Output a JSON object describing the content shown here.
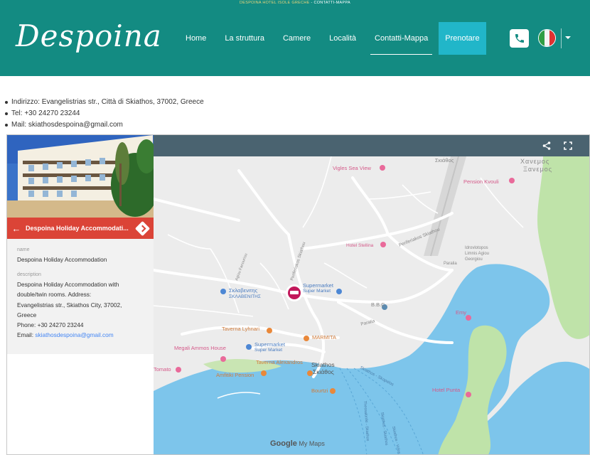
{
  "header": {
    "topline_a": "DESPOINA HOTEL ISOLE GRECHE",
    "topline_sep": " - ",
    "topline_b": "CONTATTI-MAPPA",
    "logo": "Despoina",
    "nav": [
      "Home",
      "La struttura",
      "Camere",
      "Località",
      "Contatti-Mappa"
    ],
    "book": "Prenotare",
    "phone_icon": "phone-icon",
    "language_flag": "italy-flag"
  },
  "contact": {
    "address": "Indirizzo: Evangelistrias str., Città di Skiathos, 37002, Greece",
    "tel": "Tel: +30 24270 23244",
    "mail": "Mail: skiathosdespoina@gmail.com"
  },
  "panel": {
    "title": "Despoina Holiday Accommodati...",
    "name_label": "name",
    "name_value": "Despoina Holiday Accommodation",
    "desc_label": "description",
    "desc_line1": "Despoina Holiday Accommodation with",
    "desc_line2": "double/twin rooms.  Address:",
    "desc_line3": "Evangelistrias str., Skiathos City, 37002,",
    "desc_line4": "Greece",
    "desc_phone": "Phone: +30 24270 23244",
    "desc_email_prefix": "Email: ",
    "desc_email": "skiathosdespoina@gmail.com"
  },
  "map": {
    "labels": {
      "vigles": "Vigles Sea View",
      "skiathos_top": "Σκιάθος",
      "xanemos1": "Χανεμος",
      "xanemos2": "Ξανεμος",
      "pension": "Pension Kvouli",
      "periferiakos_top": "Periferiakos Skiathou",
      "stellina": "Hotel Stellina",
      "agiou": "Agiou Fanouriou",
      "periferiakos_mid": "Periferiakos Skiathou",
      "idrovio1": "Idrovlotopos",
      "idrovio2": "Limnis Agiou",
      "idrovio3": "Georgiou",
      "paralia_top": "Paralia",
      "sklav1": "Σκλαβενιτης",
      "sklav2": "ΣΚΛΑΒΕΝΙΤΗΣ",
      "supermarket1": "Supermarket",
      "supermarket1b": "Super Market",
      "bbc": "B.B.C",
      "paralia_mid": "Paralia",
      "emy": "Emy",
      "taverna_lyhnari": "Taverna Lyhnari",
      "marmita": "MARMITA",
      "megali": "Megali Ammos House",
      "supermarket2": "Supermarket",
      "supermarket2b": "Super Market",
      "tomato": "Tomato",
      "taverna_alex": "Taverna Alexandros",
      "skiathos_city": "Skiathos",
      "skiathos_city_gr": "Σκιάθος",
      "amfitiki": "Amfitiki Pension",
      "bourtzi": "Bourtzi",
      "skopelos": "Skiathos - Skopelos",
      "hotel_punta": "Hotel Punta",
      "route1": "Skiathos - Volos",
      "route2": "Thessaloniki - Skiathos",
      "route3": "Skiathos - Skiathos"
    },
    "google": "Google",
    "mymaps": "My Maps",
    "share_icon": "share-icon",
    "fullscreen_icon": "fullscreen-icon"
  },
  "colors": {
    "header": "#138b82",
    "book": "#21b6c9",
    "place_bar": "#db4437",
    "sea": "#7dc5eb",
    "land": "#ececec",
    "green": "#bfe3a9"
  }
}
